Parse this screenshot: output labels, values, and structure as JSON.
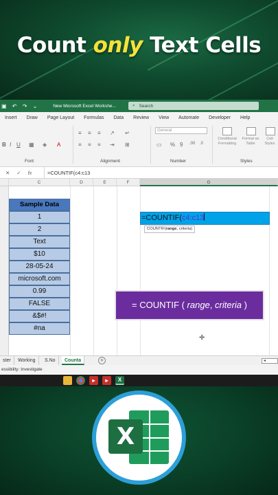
{
  "banner": {
    "title_pre": "Count ",
    "title_highlight": "only",
    "title_post": " Text Cells"
  },
  "titlebar": {
    "document": "New Microsoft Excel Workshe...",
    "search_placeholder": "Search",
    "search_icon": "search-icon"
  },
  "menu": [
    "Insert",
    "Draw",
    "Page Layout",
    "Formulas",
    "Data",
    "Review",
    "View",
    "Automate",
    "Developer",
    "Help"
  ],
  "ribbon": {
    "font_label": "Font",
    "alignment_label": "Alignment",
    "number_label": "Number",
    "styles_label": "Styles",
    "number_format": "General",
    "percent": "%",
    "comma": "9",
    "cond_format": "Conditional Formatting",
    "format_table": "Format as Table",
    "cell_styles": "Cell Styles"
  },
  "formula_bar": {
    "value": "=COUNTIF(c4:c13"
  },
  "columns": [
    "C",
    "D",
    "E",
    "F",
    "G"
  ],
  "table": {
    "header": "Sample Data",
    "values": [
      "1",
      "2",
      "Text",
      "$10",
      "28-05-24",
      "microsoft.com",
      "0.99",
      "FALSE",
      "&$#!",
      "#na"
    ]
  },
  "active_cell": {
    "prefix": "=COUNTIF(",
    "range": "c4:c13"
  },
  "tooltip": {
    "fn": "COUNTIF(",
    "arg1": "range",
    "rest": ", criteria)"
  },
  "callout": {
    "prefix": "= COUNTIF ( ",
    "arg1": "range",
    "sep": ", ",
    "arg2": "criteria",
    "suffix": " )"
  },
  "sheet_tabs": [
    "ster",
    "Working",
    "S.No",
    "Counta"
  ],
  "active_sheet": "Counta",
  "status": "essibility: Investigate",
  "colors": {
    "excel_green": "#217346",
    "table_header": "#4a78bd",
    "table_cell": "#b7cbe6",
    "active_cell": "#00a3e8",
    "callout": "#6b2d9e",
    "highlight": "#f5e23a"
  }
}
